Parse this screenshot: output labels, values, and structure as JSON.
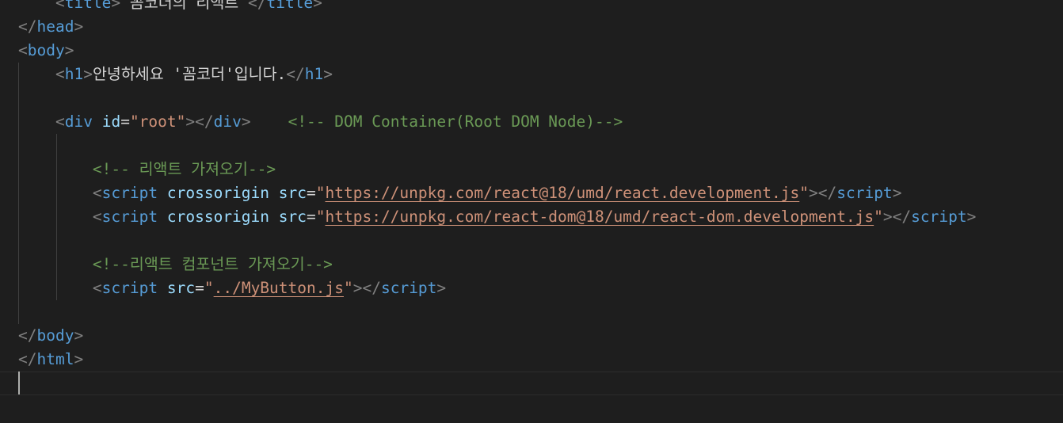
{
  "lines": [
    {
      "indent": "    ",
      "parts": [
        {
          "t": "<",
          "c": "tag-punct"
        },
        {
          "t": "title",
          "c": "tag"
        },
        {
          "t": ">",
          "c": "tag-punct"
        },
        {
          "t": " 꼼코더의 리액트 ",
          "c": "text"
        },
        {
          "t": "</",
          "c": "tag-punct"
        },
        {
          "t": "title",
          "c": "tag"
        },
        {
          "t": ">",
          "c": "tag-punct"
        }
      ]
    },
    {
      "indent": "",
      "parts": [
        {
          "t": "</",
          "c": "tag-punct"
        },
        {
          "t": "head",
          "c": "tag"
        },
        {
          "t": ">",
          "c": "tag-punct"
        }
      ]
    },
    {
      "indent": "",
      "parts": [
        {
          "t": "<",
          "c": "tag-punct"
        },
        {
          "t": "body",
          "c": "tag"
        },
        {
          "t": ">",
          "c": "tag-punct"
        }
      ]
    },
    {
      "indent": "    ",
      "parts": [
        {
          "t": "<",
          "c": "tag-punct"
        },
        {
          "t": "h1",
          "c": "tag"
        },
        {
          "t": ">",
          "c": "tag-punct"
        },
        {
          "t": "안녕하세요 '꼼코더'입니다.",
          "c": "text"
        },
        {
          "t": "</",
          "c": "tag-punct"
        },
        {
          "t": "h1",
          "c": "tag"
        },
        {
          "t": ">",
          "c": "tag-punct"
        }
      ]
    },
    {
      "indent": "",
      "parts": []
    },
    {
      "indent": "    ",
      "parts": [
        {
          "t": "<",
          "c": "tag-punct"
        },
        {
          "t": "div",
          "c": "tag"
        },
        {
          "t": " ",
          "c": "text"
        },
        {
          "t": "id",
          "c": "attr"
        },
        {
          "t": "=",
          "c": "text"
        },
        {
          "t": "\"root\"",
          "c": "str"
        },
        {
          "t": "></",
          "c": "tag-punct"
        },
        {
          "t": "div",
          "c": "tag"
        },
        {
          "t": ">",
          "c": "tag-punct"
        },
        {
          "t": "    ",
          "c": "text"
        },
        {
          "t": "<!-- DOM Container(Root DOM Node)-->",
          "c": "comment"
        }
      ]
    },
    {
      "indent": "",
      "parts": []
    },
    {
      "indent": "        ",
      "parts": [
        {
          "t": "<!-- 리액트 가져오기-->",
          "c": "comment"
        }
      ]
    },
    {
      "indent": "        ",
      "parts": [
        {
          "t": "<",
          "c": "tag-punct"
        },
        {
          "t": "script",
          "c": "tag"
        },
        {
          "t": " ",
          "c": "text"
        },
        {
          "t": "crossorigin",
          "c": "attr"
        },
        {
          "t": " ",
          "c": "text"
        },
        {
          "t": "src",
          "c": "attr"
        },
        {
          "t": "=",
          "c": "text"
        },
        {
          "t": "\"",
          "c": "str"
        },
        {
          "t": "https://unpkg.com/react@18/umd/react.development.js",
          "c": "str link"
        },
        {
          "t": "\"",
          "c": "str"
        },
        {
          "t": "></",
          "c": "tag-punct"
        },
        {
          "t": "script",
          "c": "tag"
        },
        {
          "t": ">",
          "c": "tag-punct"
        }
      ]
    },
    {
      "indent": "        ",
      "parts": [
        {
          "t": "<",
          "c": "tag-punct"
        },
        {
          "t": "script",
          "c": "tag"
        },
        {
          "t": " ",
          "c": "text"
        },
        {
          "t": "crossorigin",
          "c": "attr"
        },
        {
          "t": " ",
          "c": "text"
        },
        {
          "t": "src",
          "c": "attr"
        },
        {
          "t": "=",
          "c": "text"
        },
        {
          "t": "\"",
          "c": "str"
        },
        {
          "t": "https://unpkg.com/react-dom@18/umd/react-dom.development.js",
          "c": "str link"
        },
        {
          "t": "\"",
          "c": "str"
        },
        {
          "t": "></",
          "c": "tag-punct"
        },
        {
          "t": "script",
          "c": "tag"
        },
        {
          "t": ">",
          "c": "tag-punct"
        }
      ]
    },
    {
      "indent": "",
      "parts": []
    },
    {
      "indent": "        ",
      "parts": [
        {
          "t": "<!--리액트 컴포넌트 가져오기-->",
          "c": "comment"
        }
      ]
    },
    {
      "indent": "        ",
      "parts": [
        {
          "t": "<",
          "c": "tag-punct"
        },
        {
          "t": "script",
          "c": "tag"
        },
        {
          "t": " ",
          "c": "text"
        },
        {
          "t": "src",
          "c": "attr"
        },
        {
          "t": "=",
          "c": "text"
        },
        {
          "t": "\"",
          "c": "str"
        },
        {
          "t": "../MyButton.js",
          "c": "str link"
        },
        {
          "t": "\"",
          "c": "str"
        },
        {
          "t": "></",
          "c": "tag-punct"
        },
        {
          "t": "script",
          "c": "tag"
        },
        {
          "t": ">",
          "c": "tag-punct"
        }
      ]
    },
    {
      "indent": "",
      "parts": []
    },
    {
      "indent": "",
      "parts": [
        {
          "t": "</",
          "c": "tag-punct"
        },
        {
          "t": "body",
          "c": "tag"
        },
        {
          "t": ">",
          "c": "tag-punct"
        }
      ]
    },
    {
      "indent": "",
      "parts": [
        {
          "t": "</",
          "c": "tag-punct"
        },
        {
          "t": "html",
          "c": "tag"
        },
        {
          "t": ">",
          "c": "tag-punct"
        }
      ]
    },
    {
      "indent": "",
      "parts": []
    }
  ]
}
